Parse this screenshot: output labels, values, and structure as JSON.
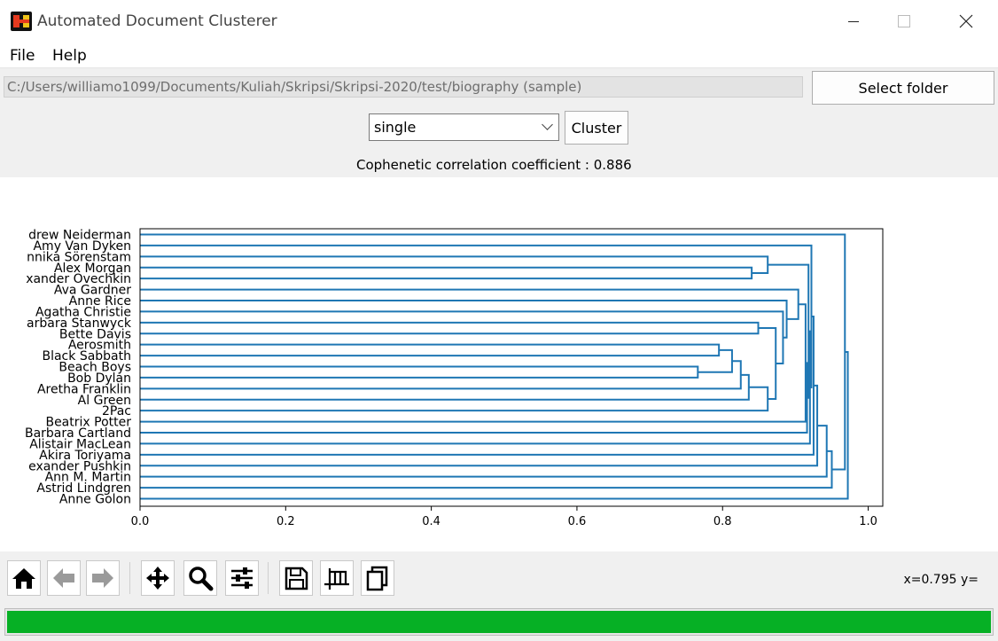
{
  "window": {
    "title": "Automated Document Clusterer",
    "min_glyph": "",
    "max_glyph": "",
    "close_glyph": "✕"
  },
  "menu": {
    "items": [
      "File",
      "Help"
    ]
  },
  "path": {
    "value": "C:/Users/williamo1099/Documents/Kuliah/Skripsi/Skripsi-2020/test/biography (sample)"
  },
  "buttons": {
    "select_folder": "Select folder",
    "cluster": "Cluster"
  },
  "method": {
    "selected": "single"
  },
  "coefficient_text": "Cophenetic correlation coefficient : 0.886",
  "colors": {
    "link": "#1f77b4",
    "progress": "#06b025"
  },
  "chart_data": {
    "type": "dendrogram",
    "orientation": "left",
    "xlim": [
      0,
      1.02
    ],
    "xticks": [
      "0.0",
      "0.2",
      "0.4",
      "0.6",
      "0.8",
      "1.0"
    ],
    "leaves": [
      "drew Neiderman",
      "Amy Van Dyken",
      "nnika Sörenstam",
      "Alex Morgan",
      "xander Ovechkin",
      "Ava Gardner",
      "Anne Rice",
      "Agatha Christie",
      "arbara Stanwyck",
      "Bette Davis",
      "Aerosmith",
      "Black Sabbath",
      "Beach Boys",
      "Bob Dylan",
      "Aretha Franklin",
      "Al Green",
      "2Pac",
      "Beatrix Potter",
      "Barbara Cartland",
      "Alistair MacLean",
      "Akira Toriyama",
      "exander Pushkin",
      "Ann M. Martin",
      "Astrid Lindgren",
      "Anne Golon"
    ],
    "merges": [
      {
        "a": "L12",
        "b": "L13",
        "h": 0.766
      },
      {
        "a": "L10",
        "b": "L11",
        "h": 0.795
      },
      {
        "a": "L3",
        "b": "L4",
        "h": 0.84
      },
      {
        "a": "N1",
        "b": "N0",
        "h": 0.813
      },
      {
        "a": "N3",
        "b": "L14",
        "h": 0.825
      },
      {
        "a": "N4",
        "b": "L15",
        "h": 0.836
      },
      {
        "a": "L8",
        "b": "L9",
        "h": 0.849
      },
      {
        "a": "L2",
        "b": "N2",
        "h": 0.862
      },
      {
        "a": "N5",
        "b": "L16",
        "h": 0.862
      },
      {
        "a": "N8",
        "b": "N6",
        "h": 0.873
      },
      {
        "a": "L7",
        "b": "N9",
        "h": 0.883
      },
      {
        "a": "L6",
        "b": "N10",
        "h": 0.888
      },
      {
        "a": "L5",
        "b": "N11",
        "h": 0.904
      },
      {
        "a": "N12",
        "b": "L17",
        "h": 0.914
      },
      {
        "a": "N13",
        "b": "L18",
        "h": 0.916
      },
      {
        "a": "N14",
        "b": "N7",
        "h": 0.918
      },
      {
        "a": "N15",
        "b": "L19",
        "h": 0.92
      },
      {
        "a": "N16",
        "b": "L1",
        "h": 0.922
      },
      {
        "a": "N17",
        "b": "L20",
        "h": 0.925
      },
      {
        "a": "N18",
        "b": "L21",
        "h": 0.93
      },
      {
        "a": "N19",
        "b": "L22",
        "h": 0.943
      },
      {
        "a": "N20",
        "b": "L23",
        "h": 0.95
      },
      {
        "a": "N21",
        "b": "L0",
        "h": 0.968
      },
      {
        "a": "N22",
        "b": "L24",
        "h": 0.972
      }
    ]
  },
  "toolbar": {
    "buttons": [
      {
        "name": "home-icon",
        "glyph": "home"
      },
      {
        "name": "back-arrow-icon",
        "glyph": "back"
      },
      {
        "name": "forward-arrow-icon",
        "glyph": "forward"
      },
      {
        "name": "pan-icon",
        "glyph": "pan"
      },
      {
        "name": "zoom-icon",
        "glyph": "zoom"
      },
      {
        "name": "configure-subplots-icon",
        "glyph": "sliders"
      },
      {
        "name": "save-icon",
        "glyph": "save"
      },
      {
        "name": "edit-axes-icon",
        "glyph": "axes"
      },
      {
        "name": "copy-icon",
        "glyph": "copy"
      }
    ],
    "coords": "x=0.795 y="
  },
  "progress": {
    "value": 1.0
  }
}
